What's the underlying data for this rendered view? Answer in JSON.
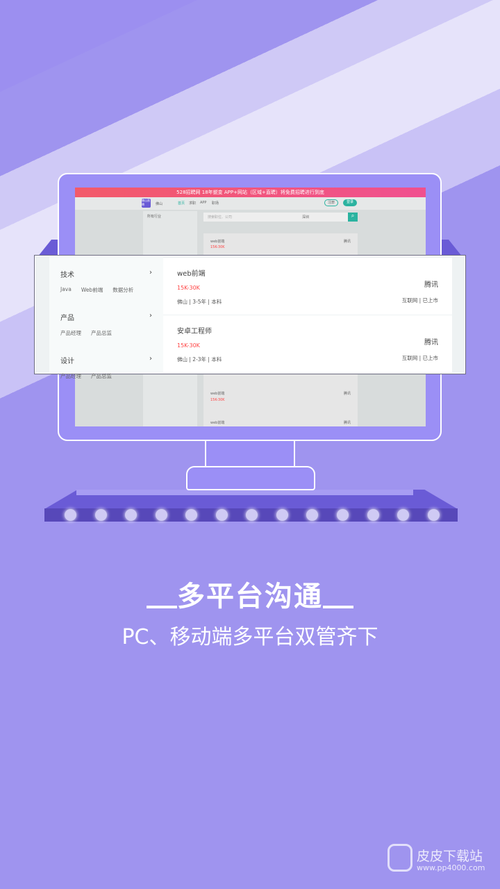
{
  "banner": "528招聘网 18年蜕变  APP+网站（区域+直聘）将免费招聘进行到底",
  "site_nav": {
    "logo": "佛山直聘",
    "city": "佛山",
    "items": [
      "首页",
      "求职",
      "APP",
      "职场"
    ],
    "register": "注册",
    "login": "登录",
    "industry": "所有行业",
    "search_placeholder": "搜索职位、公司",
    "city_select": "深圳"
  },
  "popup": {
    "categories": [
      {
        "name": "技术",
        "subs": [
          "Java",
          "Web前端",
          "数据分析"
        ]
      },
      {
        "name": "产品",
        "subs": [
          "产品经理",
          "产品总监"
        ]
      },
      {
        "name": "设计",
        "subs": [
          "产品经理",
          "产品总监"
        ]
      }
    ],
    "jobs": [
      {
        "title": "web前端",
        "salary": "15K-30K",
        "city": "佛山",
        "exp": "3-5年",
        "edu": "本科",
        "company": "腾讯",
        "industry": "互联网",
        "stage": "已上市"
      },
      {
        "title": "安卓工程师",
        "salary": "15K-30K",
        "city": "佛山",
        "exp": "2-3年",
        "edu": "本科",
        "company": "腾讯",
        "industry": "互联网",
        "stage": "已上市"
      }
    ]
  },
  "bg_jobs": [
    {
      "title": "web前端",
      "salary": "15K-30K",
      "company": "腾讯"
    },
    {
      "title": "web前端",
      "company": "腾讯"
    }
  ],
  "headline": "多平台沟通",
  "subheadline": "PC、移动端多平台双管齐下",
  "watermark": {
    "name": "皮皮下载站",
    "url": "www.pp4000.com"
  },
  "colors": {
    "accent": "#2bb3a0",
    "salary": "#ff4444",
    "bg": "#9f94ef"
  }
}
